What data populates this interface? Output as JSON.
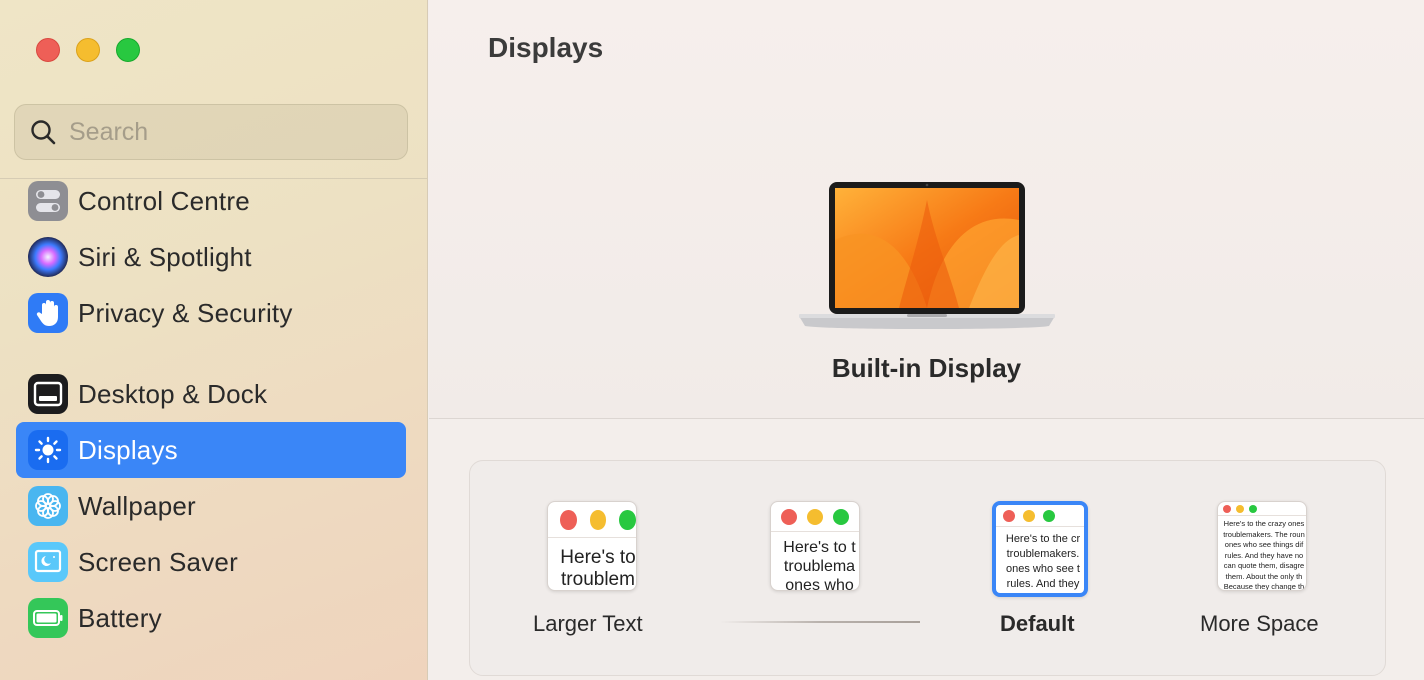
{
  "window": {
    "traffic_lights": [
      "close",
      "minimize",
      "zoom"
    ]
  },
  "sidebar": {
    "search": {
      "placeholder": "Search",
      "value": ""
    },
    "items": [
      {
        "label": "Control Centre",
        "icon": "control-centre-icon",
        "color": "#8e8e93"
      },
      {
        "label": "Siri & Spotlight",
        "icon": "siri-icon",
        "color": "#6b3fd6"
      },
      {
        "label": "Privacy & Security",
        "icon": "hand-icon",
        "color": "#2f7bf6"
      },
      {
        "label": "Desktop & Dock",
        "icon": "dock-icon",
        "color": "#1c1c1e"
      },
      {
        "label": "Displays",
        "icon": "sun-icon",
        "color": "#2f7bf6",
        "active": true
      },
      {
        "label": "Wallpaper",
        "icon": "flower-icon",
        "color": "#49b6f0"
      },
      {
        "label": "Screen Saver",
        "icon": "screen-saver-icon",
        "color": "#5ac8fa"
      },
      {
        "label": "Battery",
        "icon": "battery-icon",
        "color": "#34c759"
      }
    ]
  },
  "main": {
    "title": "Displays",
    "display_name": "Built-in Display",
    "accent": "#3a86f7",
    "resolution_options": [
      {
        "label": "Larger Text",
        "preview": [
          "Here's to",
          "troublem"
        ]
      },
      {
        "label": "",
        "preview": [
          "Here's to t",
          "troublema",
          "ones who"
        ]
      },
      {
        "label": "Default",
        "selected": true,
        "preview": [
          "Here's to the cr",
          "troublemakers.",
          "ones who see t",
          "rules. And they"
        ]
      },
      {
        "label": "More Space",
        "preview": [
          "Here's to the crazy ones",
          "troublemakers. The roun",
          "ones who see things dif",
          "rules. And they have no",
          "can quote them, disagre",
          "them. About the only th",
          "Because they change th"
        ]
      }
    ]
  }
}
